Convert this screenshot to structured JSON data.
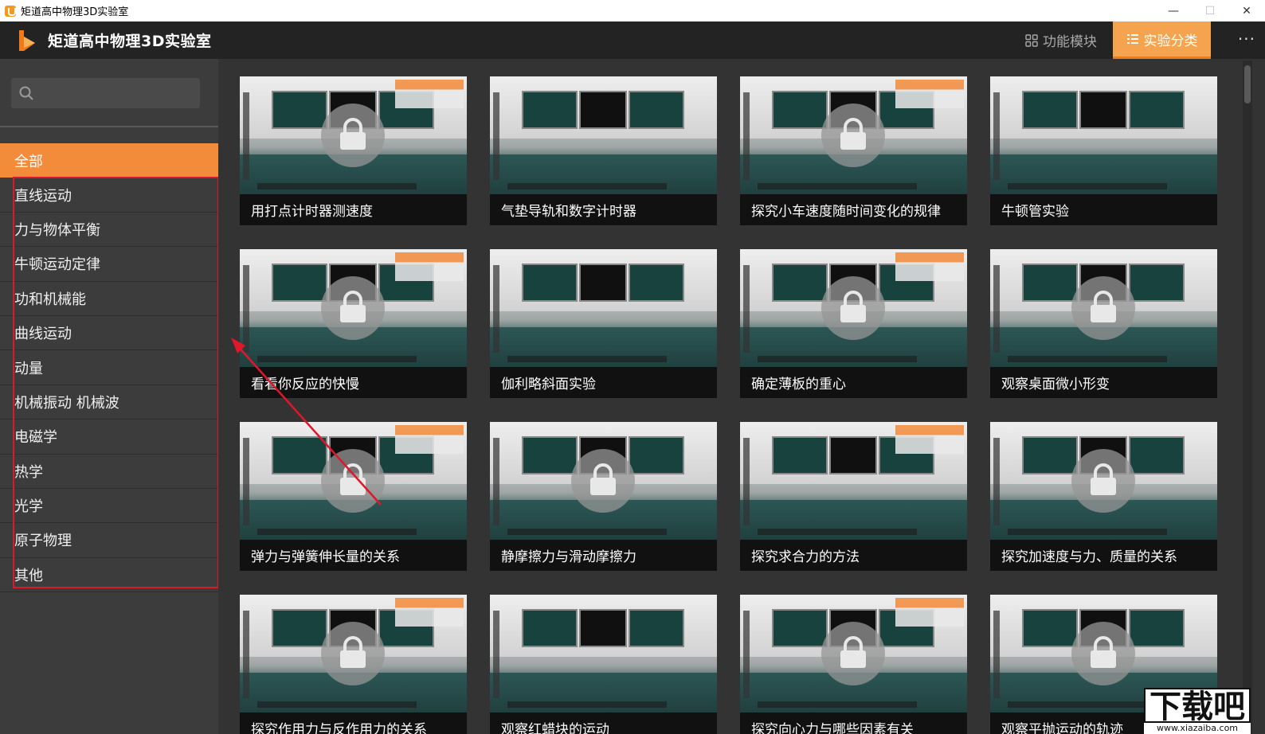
{
  "window": {
    "title": "矩道高中物理3D实验室",
    "minimize_icon": "—",
    "maximize_icon": "☐",
    "close_icon": "✕"
  },
  "header": {
    "app_title": "矩道高中物理3D实验室",
    "tabs": [
      {
        "label": "功能模块",
        "icon": "grid-icon",
        "active": false
      },
      {
        "label": "实验分类",
        "icon": "list-icon",
        "active": true
      }
    ],
    "more_label": "···",
    "accent": "#f5a34e"
  },
  "sidebar": {
    "search": {
      "placeholder": "",
      "value": ""
    },
    "categories": [
      {
        "label": "全部",
        "active": true
      },
      {
        "label": "直线运动"
      },
      {
        "label": "力与物体平衡"
      },
      {
        "label": "牛顿运动定律"
      },
      {
        "label": "功和机械能"
      },
      {
        "label": "曲线运动"
      },
      {
        "label": "动量"
      },
      {
        "label": "机械振动  机械波"
      },
      {
        "label": "电磁学"
      },
      {
        "label": "热学"
      },
      {
        "label": "光学"
      },
      {
        "label": "原子物理"
      },
      {
        "label": "其他"
      }
    ],
    "active_color": "#f28c3a",
    "highlight_color": "#e0162b"
  },
  "experiments": [
    {
      "title": "用打点计时器测速度",
      "locked": true
    },
    {
      "title": "气垫导轨和数字计时器",
      "locked": false
    },
    {
      "title": "探究小车速度随时间变化的规律",
      "locked": true
    },
    {
      "title": "牛顿管实验",
      "locked": false
    },
    {
      "title": "看看你反应的快慢",
      "locked": true
    },
    {
      "title": "伽利略斜面实验",
      "locked": false
    },
    {
      "title": "确定薄板的重心",
      "locked": true
    },
    {
      "title": "观察桌面微小形变",
      "locked": true
    },
    {
      "title": "弹力与弹簧伸长量的关系",
      "locked": true
    },
    {
      "title": "静摩擦力与滑动摩擦力",
      "locked": true
    },
    {
      "title": "探究求合力的方法",
      "locked": false
    },
    {
      "title": "探究加速度与力、质量的关系",
      "locked": true
    },
    {
      "title": "探究作用力与反作用力的关系",
      "locked": true
    },
    {
      "title": "观察红蜡块的运动",
      "locked": false
    },
    {
      "title": "探究向心力与哪些因素有关",
      "locked": true
    },
    {
      "title": "观察平抛运动的轨迹",
      "locked": true
    }
  ],
  "watermark": {
    "text": "下载吧",
    "sub": "www.xiazaiba.com"
  }
}
